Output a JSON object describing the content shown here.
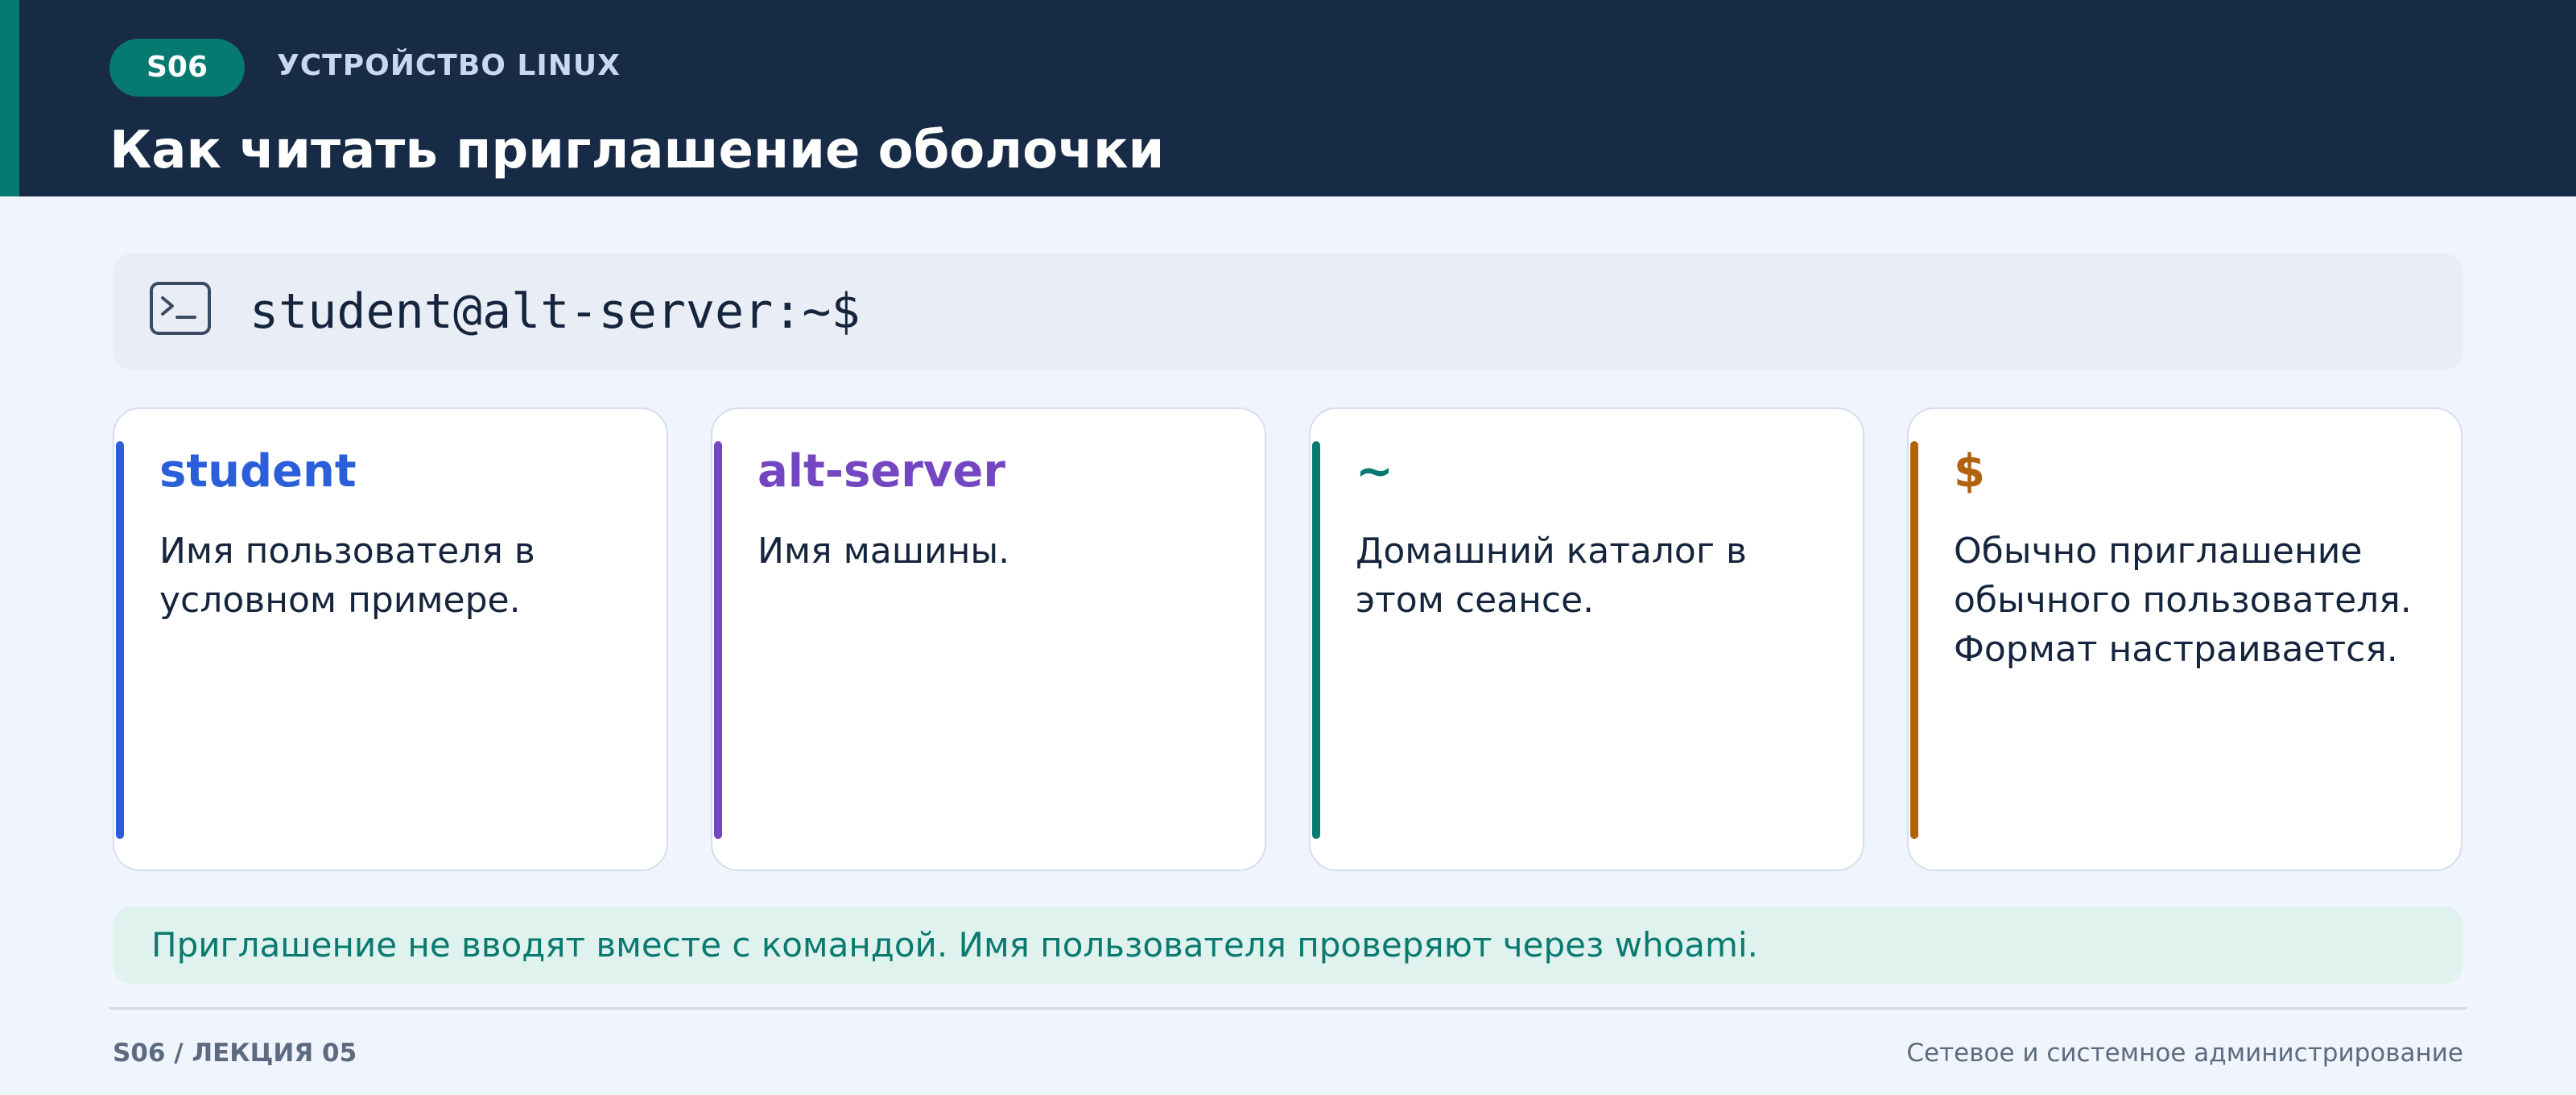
{
  "header": {
    "badge": "S06",
    "section": "УСТРОЙСТВО LINUX",
    "title": "Как читать приглашение оболочки",
    "background_color": "#172a46",
    "accent_color": "#067a70"
  },
  "prompt": {
    "icon": "terminal-icon",
    "text": "student@alt-server:~$"
  },
  "cards": [
    {
      "title": "student",
      "body": "Имя пользователя в условном примере.",
      "color": "#2b5fd9"
    },
    {
      "title": "alt-server",
      "body": "Имя машины.",
      "color": "#7446c2"
    },
    {
      "title": "~",
      "body": "Домашний каталог в этом сеансе.",
      "color": "#067a70"
    },
    {
      "title": "$",
      "body": "Обычно приглашение обычного пользователя. Формат настраивается.",
      "color": "#b0620f"
    }
  ],
  "note": {
    "text": "Приглашение не вводят вместе с командой. Имя пользователя проверяют через whoami."
  },
  "footer": {
    "left": "S06 / ЛЕКЦИЯ 05",
    "right": "Сетевое и системное администрирование"
  }
}
